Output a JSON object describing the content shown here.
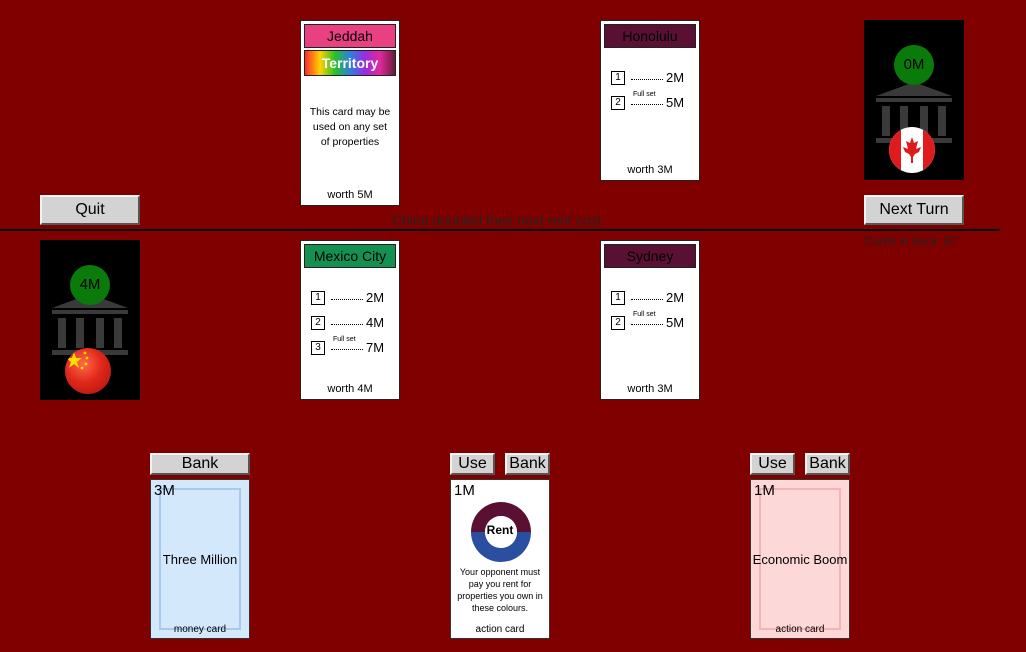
{
  "buttons": {
    "quit": "Quit",
    "next_turn": "Next Turn"
  },
  "status": {
    "message": "China doubled their next rent cost.",
    "deck_count": "Cards in deck: 67"
  },
  "opponent": {
    "bank_total": "0M",
    "flag": "canada-flag",
    "properties": [
      {
        "type": "wildcard",
        "band_label": "Jeddah",
        "band_color": "#e94081",
        "sub_label": "Territory",
        "description": "This card may be used on any set of properties",
        "worth": "worth 5M"
      },
      {
        "type": "property",
        "band_label": "Honolulu",
        "band_color": "#5a1033",
        "rent": [
          {
            "n": "1",
            "amount": "2M",
            "full_set": ""
          },
          {
            "n": "2",
            "amount": "5M",
            "full_set": "Full set"
          }
        ],
        "worth": "worth 3M"
      }
    ]
  },
  "player": {
    "bank_total": "4M",
    "flag": "china-flag",
    "properties": [
      {
        "band_label": "Mexico City",
        "band_color": "#149150",
        "rent": [
          {
            "n": "1",
            "amount": "2M",
            "full_set": ""
          },
          {
            "n": "2",
            "amount": "4M",
            "full_set": ""
          },
          {
            "n": "3",
            "amount": "7M",
            "full_set": "Full set"
          }
        ],
        "worth": "worth 4M"
      },
      {
        "band_label": "Sydney",
        "band_color": "#5a1033",
        "rent": [
          {
            "n": "1",
            "amount": "2M",
            "full_set": ""
          },
          {
            "n": "2",
            "amount": "5M",
            "full_set": "Full set"
          }
        ],
        "worth": "worth 3M"
      }
    ]
  },
  "hand": [
    {
      "value": "3M",
      "name": "Three Million",
      "type": "money card",
      "bg": "#d4e8fc",
      "border": "#a8c8ec",
      "actions": [
        "Bank"
      ]
    },
    {
      "value": "1M",
      "name": "Rent",
      "description": "Your opponent must pay you rent for properties you own in these colours.",
      "type": "action card",
      "bg": "#ffffff",
      "ring_colors": [
        "#5a1033",
        "#2a4ea0"
      ],
      "actions": [
        "Use",
        "Bank"
      ]
    },
    {
      "value": "1M",
      "name": "Economic Boom",
      "type": "action card",
      "bg": "#fdd8d8",
      "border": "#f2b4b4",
      "actions": [
        "Use",
        "Bank"
      ]
    }
  ]
}
